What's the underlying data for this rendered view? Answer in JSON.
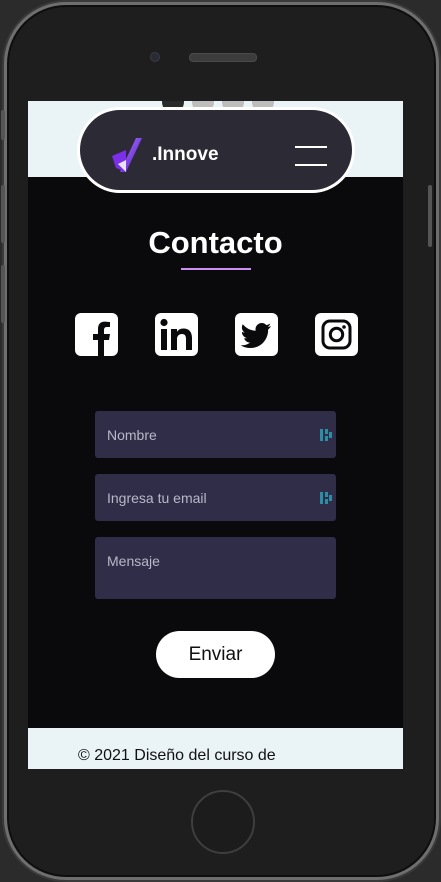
{
  "brand": {
    "name": ".Innove"
  },
  "page": {
    "title": "Contacto"
  },
  "social": [
    {
      "icon": "facebook-icon"
    },
    {
      "icon": "linkedin-icon"
    },
    {
      "icon": "twitter-icon"
    },
    {
      "icon": "instagram-icon"
    }
  ],
  "form": {
    "name_placeholder": "Nombre",
    "email_placeholder": "Ingresa tu email",
    "message_placeholder": "Mensaje",
    "submit_label": "Enviar"
  },
  "footer": {
    "text": "© 2021 Diseño del curso de"
  },
  "colors": {
    "accent": "#cf8ef2",
    "field_bg": "#2f2d48",
    "navbar_bg": "#2b2a35",
    "band_bg": "#eaf3f6"
  }
}
